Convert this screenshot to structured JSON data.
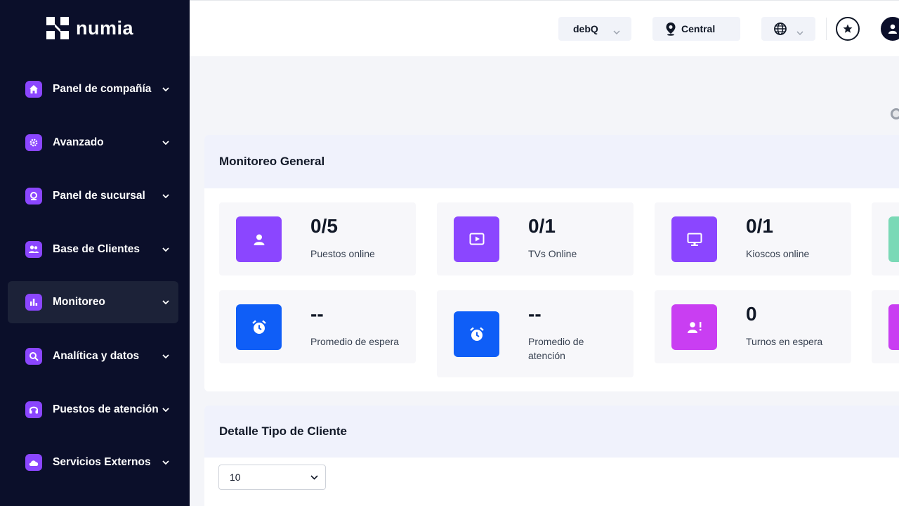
{
  "brand": {
    "name": "numia"
  },
  "sidebar": {
    "items": [
      {
        "label": "Panel de compañía",
        "icon": "home-icon"
      },
      {
        "label": "Avanzado",
        "icon": "gear-icon"
      },
      {
        "label": "Panel de sucursal",
        "icon": "location-badge-icon"
      },
      {
        "label": "Base de Clientes",
        "icon": "users-icon"
      },
      {
        "label": "Monitoreo",
        "icon": "bar-chart-icon",
        "active": true
      },
      {
        "label": "Analítica y datos",
        "icon": "analytics-search-icon"
      },
      {
        "label": "Puestos de atención",
        "icon": "headset-icon"
      },
      {
        "label": "Servicios Externos",
        "icon": "cloud-icon"
      }
    ]
  },
  "topbar": {
    "company_selector": "debQ",
    "branch_selector": "Central",
    "language_icon": "globe-icon",
    "favorites_icon": "star-icon",
    "user_icon": "user-icon"
  },
  "monitoring": {
    "title": "Monitoreo General",
    "stats": [
      {
        "value": "0/5",
        "label": "Puestos online",
        "icon": "user-icon",
        "color": "#8b46ff"
      },
      {
        "value": "0/1",
        "label": "TVs Online",
        "icon": "play-screen-icon",
        "color": "#8b46ff"
      },
      {
        "value": "0/1",
        "label": "Kioscos online",
        "icon": "monitor-icon",
        "color": "#8b46ff"
      },
      {
        "value": "--",
        "label": "Promedio de espera",
        "icon": "alarm-clock-icon",
        "color": "#0f5ef7"
      },
      {
        "value": "--",
        "label": "Promedio de atención",
        "icon": "alarm-clock-icon",
        "color": "#0f5ef7"
      },
      {
        "value": "0",
        "label": "Turnos en espera",
        "icon": "user-alert-icon",
        "color": "#c93ef2"
      }
    ]
  },
  "client_detail": {
    "title": "Detalle Tipo de Cliente",
    "page_size": "10"
  }
}
